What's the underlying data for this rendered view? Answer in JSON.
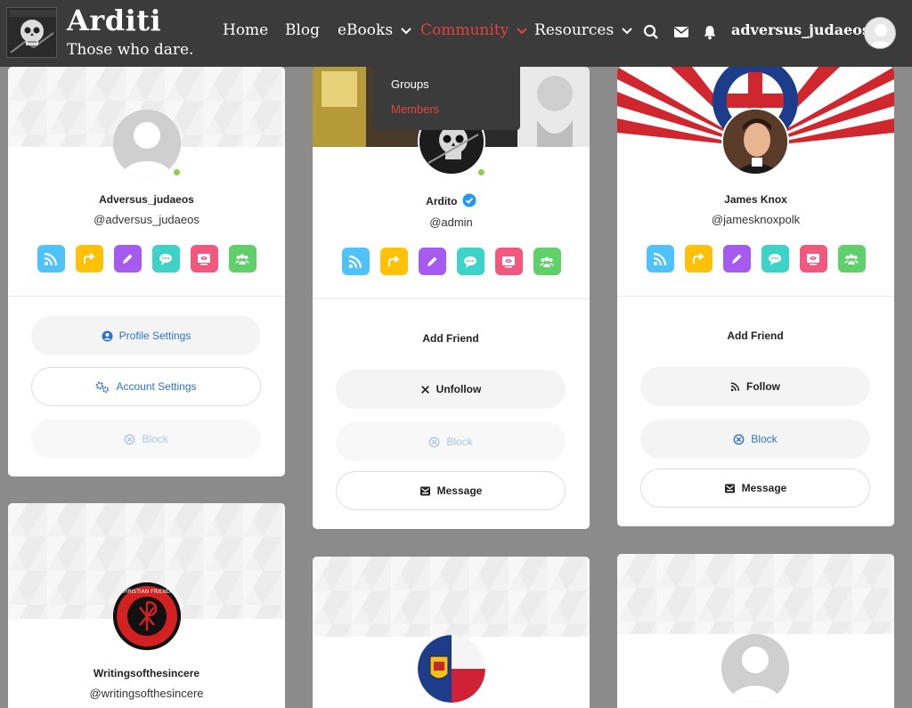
{
  "site": {
    "title": "Arditi",
    "tagline": "Those who dare."
  },
  "nav": {
    "home": "Home",
    "blog": "Blog",
    "ebooks": "eBooks",
    "community": "Community",
    "resources": "Resources",
    "user": "adversus_judaeos"
  },
  "dropdown": {
    "groups": "Groups",
    "members": "Members"
  },
  "colors": {
    "header": "#3b3b3b",
    "accent": "#e0443c",
    "rss": "#4fc3f7",
    "share": "#ffc107",
    "edit": "#a55bf0",
    "chat": "#3ed3c8",
    "screen": "#f2577e",
    "group": "#5fd06a"
  },
  "cards": [
    {
      "name": "Adversus_judaeos",
      "handle": "@adversus_judaeos",
      "buttons": {
        "profile": "Profile Settings",
        "account": "Account Settings",
        "block": "Block"
      }
    },
    {
      "name": "Ardito",
      "handle": "@admin",
      "buttons": {
        "add": "Add Friend",
        "unfollow": "Unfollow",
        "block": "Block",
        "message": "Message"
      }
    },
    {
      "name": "James Knox",
      "handle": "@jamesknoxpolk",
      "buttons": {
        "add": "Add Friend",
        "follow": "Follow",
        "block": "Block",
        "message": "Message"
      }
    },
    {
      "name": "Writingsofthesincere",
      "handle": "@writingsofthesincere",
      "badge_text": "CHRISTIAN FRIENDS"
    }
  ],
  "icons": [
    "rss-icon",
    "share-icon",
    "pencil-icon",
    "chat-bubble-icon",
    "screen-icon",
    "group-icon"
  ]
}
